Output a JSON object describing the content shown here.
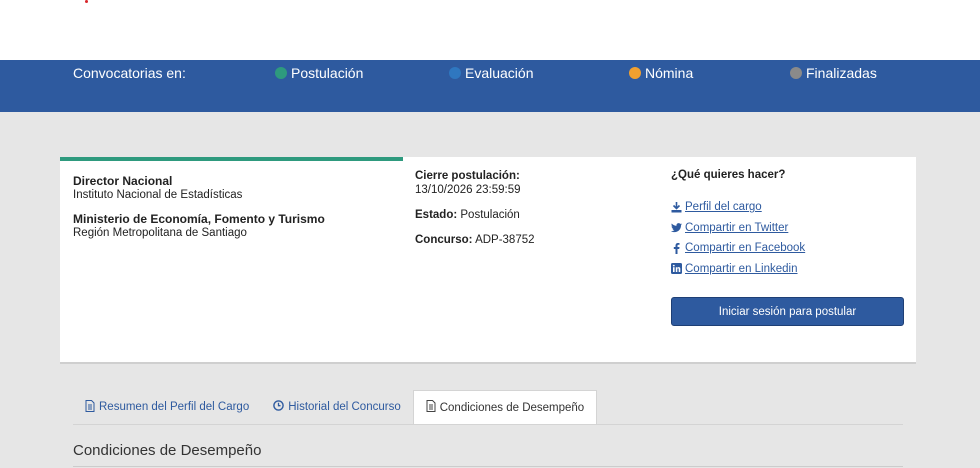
{
  "statusbar": {
    "label": "Convocatorias en:",
    "items": [
      {
        "label": "Postulación",
        "color": "#2e9a7e"
      },
      {
        "label": "Evaluación",
        "color": "#2f77c0"
      },
      {
        "label": "Nómina",
        "color": "#f0a030"
      },
      {
        "label": "Finalizadas",
        "color": "#8a8a8a"
      }
    ]
  },
  "position": {
    "title": "Director Nacional",
    "institution": "Instituto Nacional de Estadísticas",
    "ministry": "Ministerio de Economía, Fomento y Turismo",
    "region": "Región Metropolitana de Santiago"
  },
  "details": {
    "close_label": "Cierre postulación:",
    "close_value": "13/10/2026 23:59:59",
    "state_label": "Estado:",
    "state_value": "Postulación",
    "contest_label": "Concurso:",
    "contest_value": "ADP-38752"
  },
  "actions": {
    "heading": "¿Qué quieres hacer?",
    "links": [
      {
        "label": "Perfil del cargo",
        "icon": "download-icon"
      },
      {
        "label": "Compartir en Twitter",
        "icon": "twitter-icon"
      },
      {
        "label": "Compartir en Facebook",
        "icon": "facebook-icon"
      },
      {
        "label": "Compartir en Linkedin",
        "icon": "linkedin-icon"
      }
    ],
    "login_button": "Iniciar sesión para postular"
  },
  "tabs": [
    {
      "label": "Resumen del Perfil del Cargo",
      "icon": "document-icon",
      "active": false
    },
    {
      "label": "Historial del Concurso",
      "icon": "clock-icon",
      "active": false
    },
    {
      "label": "Condiciones de Desempeño",
      "icon": "document-icon",
      "active": true
    }
  ],
  "section_title": "Condiciones de Desempeño"
}
